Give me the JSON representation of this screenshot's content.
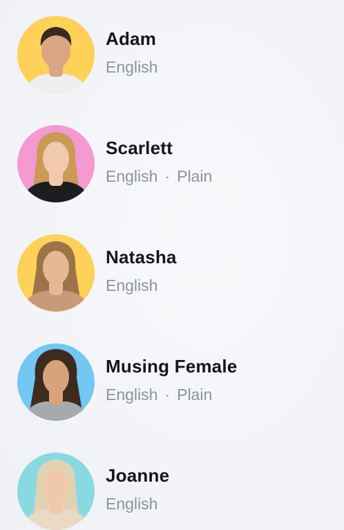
{
  "voices": [
    {
      "name": "Adam",
      "language": "English",
      "style": "",
      "bg": "#fdd15a",
      "hair": "#3a2a1e",
      "skin": "#d9a582",
      "shirt": "#eeeeee",
      "long_hair": false
    },
    {
      "name": "Scarlett",
      "language": "English",
      "style": "Plain",
      "bg": "#f49ad0",
      "hair": "#c99a58",
      "skin": "#f0c9ae",
      "shirt": "#1d1d1f",
      "long_hair": true
    },
    {
      "name": "Natasha",
      "language": "English",
      "style": "",
      "bg": "#fdd15a",
      "hair": "#9c7448",
      "skin": "#e7b894",
      "shirt": "#c99a7a",
      "long_hair": true
    },
    {
      "name": "Musing Female",
      "language": "English",
      "style": "Plain",
      "bg": "#74c6f3",
      "hair": "#3e2a1f",
      "skin": "#d8a27c",
      "shirt": "#a7a9ad",
      "long_hair": true
    },
    {
      "name": "Joanne",
      "language": "English",
      "style": "",
      "bg": "#8ad9e0",
      "hair": "#e2d2b4",
      "skin": "#f0c9ad",
      "shirt": "#ead9c4",
      "long_hair": true
    }
  ],
  "separator": "·"
}
